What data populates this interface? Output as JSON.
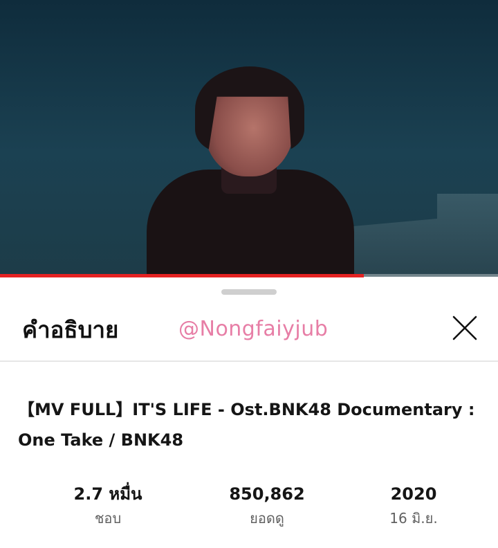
{
  "video": {
    "progress_fraction": 0.73
  },
  "sheet": {
    "title": "คำอธิบาย",
    "watermark": "@Nongfaiyjub",
    "close_icon": "close-x-icon"
  },
  "description": {
    "title": "【MV FULL】IT'S LIFE - Ost.BNK48 Documentary : One Take  / BNK48"
  },
  "stats": [
    {
      "value": "2.7 หมื่น",
      "label": "ชอบ"
    },
    {
      "value": "850,862",
      "label": "ยอดดู"
    },
    {
      "value": "2020",
      "label": "16 มิ.ย."
    }
  ],
  "colors": {
    "progress": "#e52222",
    "watermark": "#e77ea6"
  }
}
